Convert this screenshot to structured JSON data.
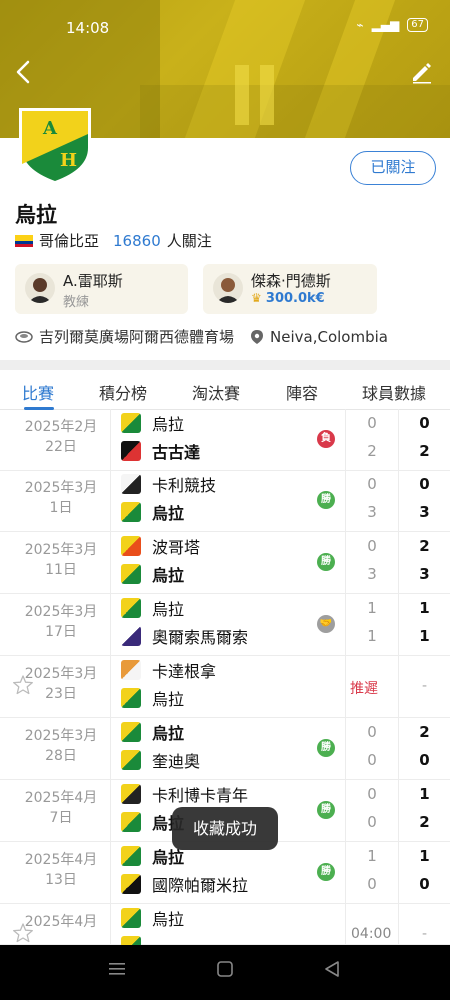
{
  "status": {
    "time": "14:08",
    "battery": "67"
  },
  "team": {
    "name": "烏拉",
    "country": "哥倫比亞",
    "followers": "16860",
    "followers_suffix": "人關注",
    "follow_button": "已關注",
    "logo_letters": [
      "A",
      "H"
    ]
  },
  "coach": {
    "name": "A.雷耶斯",
    "role": "教練"
  },
  "star_player": {
    "name": "傑森·門德斯",
    "value": "300.0k€"
  },
  "venue": {
    "stadium": "吉列爾莫廣場阿爾西德體育場",
    "city": "Neiva,Colombia"
  },
  "tabs": [
    "比賽",
    "積分榜",
    "淘汰賽",
    "陣容",
    "球員數據"
  ],
  "matches": [
    {
      "date1": "2025年2月",
      "date2": "22日",
      "home": "烏拉",
      "away": "古古達",
      "home_bold": false,
      "away_bold": true,
      "result": "負",
      "result_type": "loss",
      "ht": [
        "0",
        "2"
      ],
      "ft": [
        "0",
        "2"
      ]
    },
    {
      "date1": "2025年3月",
      "date2": "1日",
      "home": "卡利競技",
      "away": "烏拉",
      "home_bold": false,
      "away_bold": true,
      "result": "勝",
      "result_type": "win",
      "ht": [
        "0",
        "3"
      ],
      "ft": [
        "0",
        "3"
      ]
    },
    {
      "date1": "2025年3月",
      "date2": "11日",
      "home": "波哥塔",
      "away": "烏拉",
      "home_bold": false,
      "away_bold": true,
      "result": "勝",
      "result_type": "win",
      "ht": [
        "0",
        "3"
      ],
      "ft": [
        "2",
        "3"
      ]
    },
    {
      "date1": "2025年3月",
      "date2": "17日",
      "home": "烏拉",
      "away": "奧爾索馬爾索",
      "home_bold": false,
      "away_bold": false,
      "result": "",
      "result_type": "draw",
      "ht": [
        "1",
        "1"
      ],
      "ft": [
        "1",
        "1"
      ]
    },
    {
      "date1": "2025年3月",
      "date2": "23日",
      "home": "卡達根拿",
      "away": "烏拉",
      "home_bold": false,
      "away_bold": false,
      "status": "推遲",
      "dash": "-"
    },
    {
      "date1": "2025年3月",
      "date2": "28日",
      "home": "烏拉",
      "away": "奎迪奧",
      "home_bold": true,
      "away_bold": false,
      "result": "勝",
      "result_type": "win",
      "ht": [
        "0",
        "0"
      ],
      "ft": [
        "2",
        "0"
      ]
    },
    {
      "date1": "2025年4月",
      "date2": "7日",
      "home": "卡利博卡青年",
      "away": "烏拉",
      "home_bold": false,
      "away_bold": true,
      "result": "勝",
      "result_type": "win",
      "ht": [
        "0",
        "0"
      ],
      "ft": [
        "1",
        "2"
      ]
    },
    {
      "date1": "2025年4月",
      "date2": "13日",
      "home": "烏拉",
      "away": "國際帕爾米拉",
      "home_bold": true,
      "away_bold": false,
      "result": "勝",
      "result_type": "win",
      "ht": [
        "1",
        "0"
      ],
      "ft": [
        "1",
        "0"
      ]
    },
    {
      "date1": "2025年4月",
      "date2": "",
      "home": "烏拉",
      "away": "",
      "home_bold": false,
      "away_bold": false,
      "kickoff": "04:00",
      "dash": "-"
    }
  ],
  "toast": "收藏成功",
  "colors": {
    "accent": "#2f7ad0",
    "win": "#4caf50",
    "loss": "#d9394a",
    "banner": "#c2aa16"
  }
}
